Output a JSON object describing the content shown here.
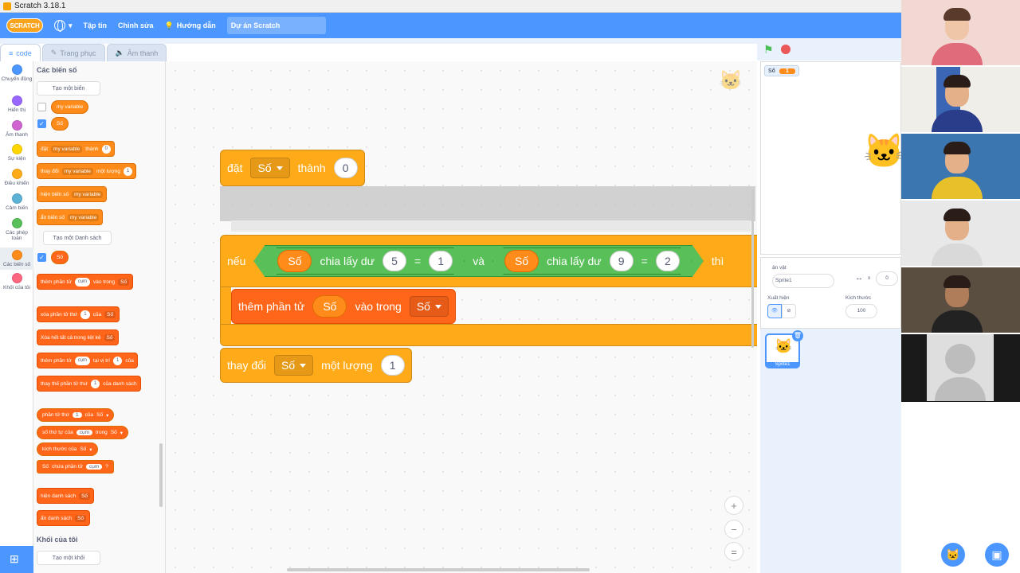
{
  "window": {
    "title": "Scratch 3.18.1"
  },
  "menubar": {
    "logo": "SCRATCH",
    "items": [
      "Tập tin",
      "Chỉnh sửa"
    ],
    "tutorial": "Hướng dẫn",
    "project_name": "Dự án Scratch"
  },
  "tabs": {
    "code": "code",
    "costumes": "Trang phục",
    "sounds": "Âm thanh"
  },
  "categories": [
    {
      "label": "Chuyển động",
      "color": "#4c97ff"
    },
    {
      "label": "Hiển thị",
      "color": "#9966ff"
    },
    {
      "label": "Âm thanh",
      "color": "#cf63cf"
    },
    {
      "label": "Sự kiện",
      "color": "#ffd500"
    },
    {
      "label": "Điều khiển",
      "color": "#ffab19"
    },
    {
      "label": "Cảm biến",
      "color": "#5cb1d6"
    },
    {
      "label": "Các phép toán",
      "color": "#59c059"
    },
    {
      "label": "Các biến số",
      "color": "#ff8c1a"
    },
    {
      "label": "Khối của tôi",
      "color": "#ff6680"
    }
  ],
  "palette": {
    "section_vars": "Các biến số",
    "make_var": "Tạo một biến",
    "var1": "my variable",
    "var2": "Số",
    "set_block": {
      "a": "đặt",
      "var": "my variable",
      "b": "thành",
      "val": "0"
    },
    "change_block": {
      "a": "thay đổi",
      "var": "my variable",
      "b": "một lượng",
      "val": "1"
    },
    "show_var": {
      "a": "hiện biến số",
      "var": "my variable"
    },
    "hide_var": {
      "a": "ẩn biến số",
      "var": "my variable"
    },
    "make_list": "Tạo một Danh sách",
    "list1": "Số",
    "add_to_list": {
      "a": "thêm phần tử",
      "item": "cụm",
      "b": "vào trong",
      "list": "Số"
    },
    "delete_item": {
      "a": "xóa phần tử thứ",
      "n": "1",
      "b": "của",
      "list": "Số"
    },
    "delete_all": {
      "a": "Xóa hết tất cả trong liệt kê",
      "list": "Số"
    },
    "insert_at": {
      "a": "thêm phần tử",
      "item": "cụm",
      "b": "tại vị trí",
      "n": "1",
      "c": "của",
      "list": "Số"
    },
    "replace_item": {
      "a": "thay thế phần tử thứ",
      "n": "1",
      "b": "của danh sách",
      "list": "Số"
    },
    "item_of": {
      "a": "phần tử thứ",
      "n": "1",
      "b": "của",
      "list": "Số"
    },
    "index_of": {
      "a": "số thứ tự của",
      "item": "cụm",
      "b": "trong",
      "list": "Số"
    },
    "length_of": {
      "a": "kích thước của",
      "list": "Số"
    },
    "contains": {
      "list": "Số",
      "a": "chứa phần tử",
      "item": "cụm",
      "q": "?"
    },
    "show_list": {
      "a": "hiện danh sách",
      "list": "Số"
    },
    "hide_list": {
      "a": "ẩn danh sách",
      "list": "Số"
    },
    "section_my": "Khối của tôi",
    "make_block": "Tạo một khối"
  },
  "script": {
    "set": {
      "a": "đặt",
      "var": "Số",
      "b": "thành",
      "val": "0"
    },
    "if": {
      "kw": "nếu",
      "then": "thì",
      "left": {
        "var": "Số",
        "op": "chia lấy dư",
        "n": "5",
        "eq": "=",
        "r": "1"
      },
      "and": "và",
      "right": {
        "var": "Số",
        "op": "chia lấy dư",
        "n": "9",
        "eq": "=",
        "r": "2"
      }
    },
    "add": {
      "a": "thêm phần tử",
      "item": "Số",
      "b": "vào trong",
      "list": "Số"
    },
    "change": {
      "a": "thay đổi",
      "var": "Số",
      "b": "một lượng",
      "val": "1"
    }
  },
  "zoom": {
    "in": "+",
    "out": "−",
    "reset": "="
  },
  "stage": {
    "monitor_label": "Số",
    "monitor_value": "1"
  },
  "sprite_info": {
    "sprite_label": "ận vật",
    "sprite_name": "Sprite1",
    "x_label": "x",
    "x_value": "0",
    "show_label": "Xuất hiện",
    "size_label": "Kích thước",
    "size_value": "100"
  },
  "sprite_list": {
    "name": "Sprite1"
  }
}
